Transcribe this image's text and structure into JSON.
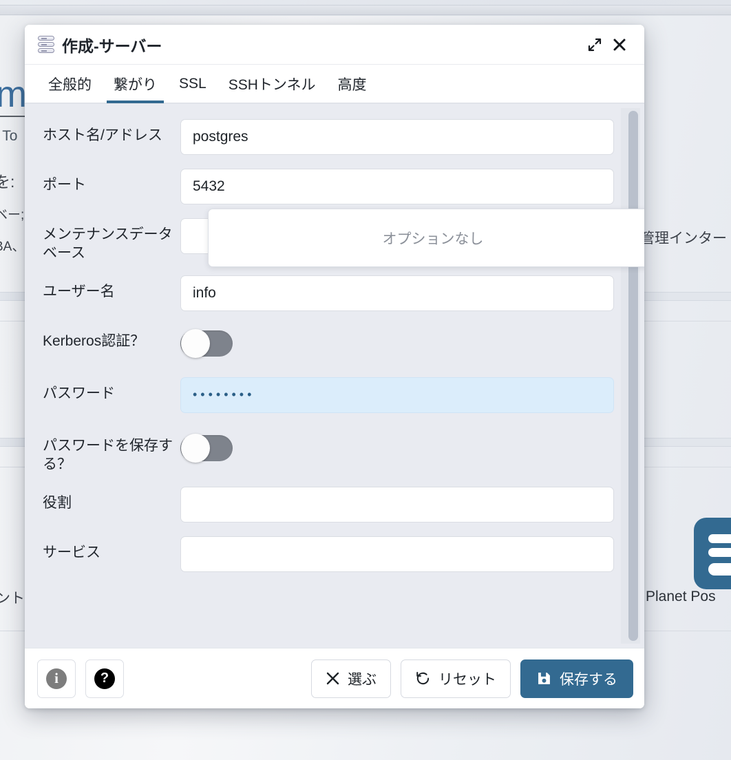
{
  "background": {
    "heading_fragment": "m",
    "line1": "; To",
    "line2": "を:",
    "line3": "ベー;",
    "line4": "BA、",
    "bottom_text": "ント",
    "right_text": "管理インター",
    "logo_label": "Planet Pos"
  },
  "dialog": {
    "title": "作成-サーバー",
    "title_icon": "server-stack-icon",
    "maximize_icon": "maximize-icon",
    "close_icon": "close-icon",
    "tabs": [
      {
        "label": "全般的",
        "active": false
      },
      {
        "label": "繋がり",
        "active": true
      },
      {
        "label": "SSL",
        "active": false
      },
      {
        "label": "SSHトンネル",
        "active": false
      },
      {
        "label": "高度",
        "active": false
      }
    ],
    "fields": [
      {
        "label": "ホスト名/アドレス",
        "type": "text",
        "value": "postgres"
      },
      {
        "label": "ポート",
        "type": "text",
        "value": "5432"
      },
      {
        "label": "メンテナンスデータベース",
        "type": "select",
        "value": ""
      },
      {
        "label": "ユーザー名",
        "type": "text",
        "value": "info"
      },
      {
        "label": "Kerberos認証？",
        "type": "toggle",
        "value": "off"
      },
      {
        "label": "パスワード",
        "type": "password",
        "value": "••••••••"
      },
      {
        "label": "パスワードを保存する？",
        "type": "toggle",
        "value": "off"
      },
      {
        "label": "役割",
        "type": "text",
        "value": ""
      },
      {
        "label": "サービス",
        "type": "text",
        "value": ""
      }
    ],
    "dropdown": {
      "empty_message": "オプションなし"
    },
    "footer": {
      "info_label": "i",
      "help_label": "?",
      "cancel_label": "選ぶ",
      "reset_label": "リセット",
      "save_label": "保存する"
    }
  },
  "colors": {
    "accent": "#336a91",
    "toggle_off_track": "#7e838c",
    "password_field_bg": "#dbedfb",
    "body_bg": "#e9ebf1"
  }
}
